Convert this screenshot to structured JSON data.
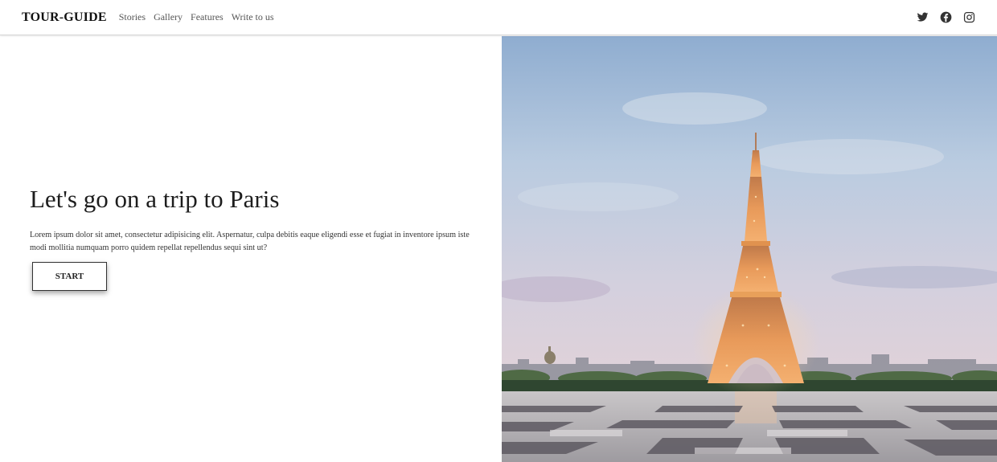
{
  "header": {
    "brand": "TOUR-GUIDE",
    "nav": [
      {
        "label": "Stories"
      },
      {
        "label": "Gallery"
      },
      {
        "label": "Features"
      },
      {
        "label": "Write to us"
      }
    ],
    "social": [
      {
        "icon": "twitter-icon"
      },
      {
        "icon": "facebook-icon"
      },
      {
        "icon": "instagram-icon"
      }
    ]
  },
  "hero": {
    "title": "Let's go on a trip to Paris",
    "body": "Lorem ipsum dolor sit amet, consectetur adipisicing elit. Aspernatur, culpa debitis eaque eligendi esse et fugiat in inventore ipsum iste modi mollitia numquam porro quidem repellat repellendus sequi sint ut?",
    "button_label": "START"
  },
  "image": {
    "subject": "eiffel-tower-photo"
  },
  "colors": {
    "text_dark": "#1d1d1d",
    "nav_text": "#555555",
    "sky_top": "#97b3d2",
    "sky_bottom": "#d9cfdc",
    "tower_glow": "#f0a860"
  }
}
